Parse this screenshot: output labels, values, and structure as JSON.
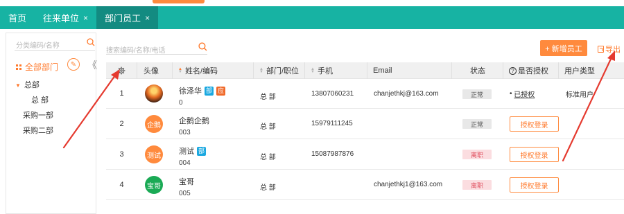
{
  "tabs": [
    {
      "label": "首页",
      "closable": false
    },
    {
      "label": "往来单位",
      "closable": true,
      "close_glyph": "×"
    },
    {
      "label": "部门员工",
      "closable": true,
      "close_glyph": "×",
      "active": true
    }
  ],
  "sidebar": {
    "search_placeholder": "分类编码/名称",
    "all_label": "全部部门",
    "edit_glyph": "✎",
    "collapse_glyph": "《",
    "tree": [
      {
        "label": "总部",
        "expanded": true
      },
      {
        "label": "总 部"
      },
      {
        "label": "采购一部"
      },
      {
        "label": "采购二部"
      }
    ]
  },
  "toolbar": {
    "search_placeholder": "搜索编码/名称/电话",
    "new_button": "+ 新增员工",
    "export_button": "导出"
  },
  "table": {
    "columns": {
      "avatar": "头像",
      "name": "姓名/编码",
      "dept": "部门/职位",
      "phone": "手机",
      "email": "Email",
      "status": "状态",
      "auth": "是否授权",
      "auth_help_icon": "?",
      "user_type": "用户类型"
    },
    "rows": [
      {
        "index": "1",
        "avatar_text": "",
        "name": "徐泽华",
        "tags": [
          "部",
          "应"
        ],
        "code": "0",
        "dept": "总 部",
        "phone": "13807060231",
        "email": "chanjethkj@163.com",
        "status": "正常",
        "auth_text": "已授权",
        "auth_bullet": "•",
        "user_type": "标准用户"
      },
      {
        "index": "2",
        "avatar_text": "企鹅",
        "name": "企鹅企鹅",
        "tags": [],
        "code": "003",
        "dept": "总 部",
        "phone": "15979111245",
        "email": "",
        "status": "正常",
        "auth_button": "授权登录",
        "user_type": ""
      },
      {
        "index": "3",
        "avatar_text": "测试",
        "name": "测试",
        "tags": [
          "部"
        ],
        "code": "004",
        "dept": "总 部",
        "phone": "15087987876",
        "email": "",
        "status": "离职",
        "auth_button": "授权登录",
        "user_type": ""
      },
      {
        "index": "4",
        "avatar_text": "宝哥",
        "name": "宝哥",
        "tags": [],
        "code": "005",
        "dept": "总 部",
        "phone": "",
        "email": "chanjethkj1@163.com",
        "status": "离职",
        "auth_button": "授权登录",
        "user_type": ""
      }
    ]
  },
  "icons": {
    "settings": "gear-icon",
    "search": "search-icon",
    "export": "export-icon",
    "edit": "edit-icon",
    "collapse": "collapse-left-icon"
  },
  "colors": {
    "tabbar": "#17b3a3",
    "tab_active": "#138b81",
    "accent": "#ff8a3d",
    "status_left": "#e04f5f",
    "annotation_arrow": "#e53a2f"
  }
}
